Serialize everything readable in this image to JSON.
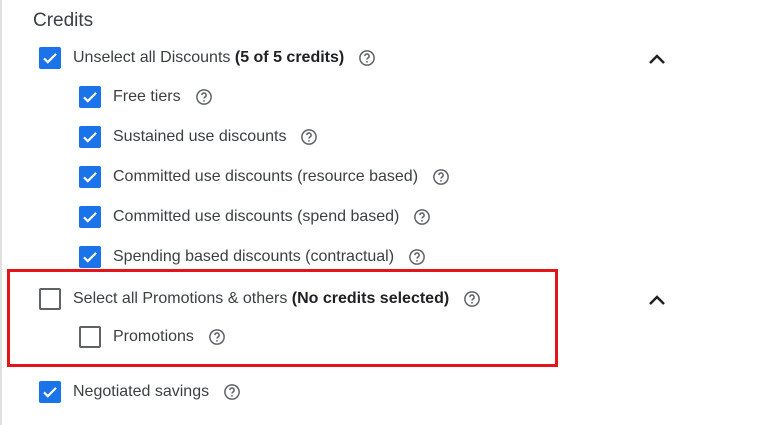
{
  "section": {
    "title": "Credits"
  },
  "discounts": {
    "select_all": {
      "label": "Unselect all Discounts",
      "count": "(5 of 5 credits)",
      "checked": true
    },
    "items": [
      {
        "label": "Free tiers",
        "checked": true
      },
      {
        "label": "Sustained use discounts",
        "checked": true
      },
      {
        "label": "Committed use discounts (resource based)",
        "checked": true
      },
      {
        "label": "Committed use discounts (spend based)",
        "checked": true
      },
      {
        "label": "Spending based discounts (contractual)",
        "checked": true
      }
    ]
  },
  "promotions": {
    "select_all": {
      "label": "Select all Promotions & others",
      "count": "(No credits selected)",
      "checked": false
    },
    "items": [
      {
        "label": "Promotions",
        "checked": false
      }
    ]
  },
  "negotiated": {
    "label": "Negotiated savings",
    "checked": true
  },
  "icons": {
    "help": "help-circle-icon",
    "collapse": "chevron-up-icon",
    "check": "check-icon"
  },
  "colors": {
    "accent": "#1a73e8",
    "highlight": "#e3151a",
    "text": "#3c4043"
  }
}
